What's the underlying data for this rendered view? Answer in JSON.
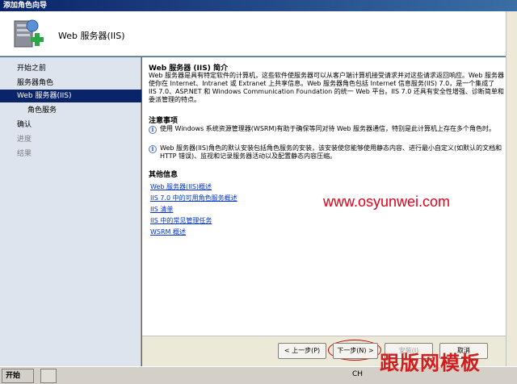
{
  "window": {
    "title": "添加角色向导"
  },
  "header": {
    "title": "Web 服务器(IIS)"
  },
  "nav": {
    "items": [
      {
        "label": "开始之前",
        "state": "normal"
      },
      {
        "label": "服务器角色",
        "state": "normal"
      },
      {
        "label": "Web 服务器(IIS)",
        "state": "active"
      },
      {
        "label": "角色服务",
        "state": "normal"
      },
      {
        "label": "确认",
        "state": "normal"
      },
      {
        "label": "进度",
        "state": "disabled"
      },
      {
        "label": "结果",
        "state": "disabled"
      }
    ]
  },
  "content": {
    "intro_title": "Web 服务器 (IIS) 简介",
    "intro_text": "Web 服务器是具有特定软件的计算机，这些软件使服务器可以从客户端计算机接受请求并对这些请求返回响应。Web 服务器使你在 Internet、Intranet 或 Extranet 上共享信息。Web 服务器角色包括 Internet 信息服务(IIS) 7.0，是一个集成了 IIS 7.0、ASP.NET 和 Windows Communication Foundation 的统一 Web 平台。IIS 7.0 还具有安全性增强、诊断简单和委派管理的特点。",
    "notes_title": "注意事项",
    "notes": [
      "使用 Windows 系统资源管理器(WSRM)有助于确保等同对待 Web 服务器通信，特别是此计算机上存在多个角色时。",
      "Web 服务器(IIS)角色的默认安装包括角色服务的安装，该安装使您能够使用静态内容、进行最小自定义(如默认的文档和 HTTP 错误)、监视和记录服务器活动以及配置静态内容压缩。"
    ],
    "more_title": "其他信息",
    "links": [
      "Web 服务器(IIS)概述",
      "IIS 7.0 中的可用角色服务概述",
      "IIS 清单",
      "IIS 中的常见管理任务",
      "WSRM 概述"
    ],
    "watermark": "www.osyunwei.com"
  },
  "buttons": {
    "back": "< 上一步(P)",
    "next": "下一步(N) >",
    "install": "安装(I)",
    "cancel": "取消"
  },
  "taskbar": {
    "start": "开始",
    "tray": "CH",
    "brand": "跟版网模板"
  }
}
